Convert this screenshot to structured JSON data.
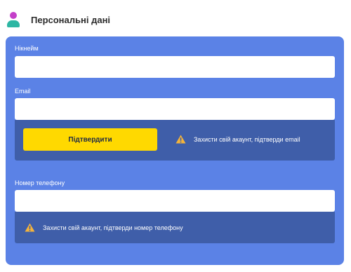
{
  "header": {
    "icon": "user-icon",
    "title": "Персональні дані"
  },
  "colors": {
    "panel": "#5b82e6",
    "notice": "#3f5ea9",
    "button": "#ffd900",
    "warning": "#f5b43a"
  },
  "form": {
    "nickname": {
      "label": "Нікнейм",
      "value": ""
    },
    "email": {
      "label": "Email",
      "value": "",
      "confirm_label": "Підтвердити",
      "warning_icon": "warning-icon",
      "warning_text": "Захисти свій акаунт, підтверди email"
    },
    "phone": {
      "label": "Номер телефону",
      "value": "",
      "warning_icon": "warning-icon",
      "warning_text": "Захисти свій акаунт, підтверди номер телефону"
    }
  }
}
